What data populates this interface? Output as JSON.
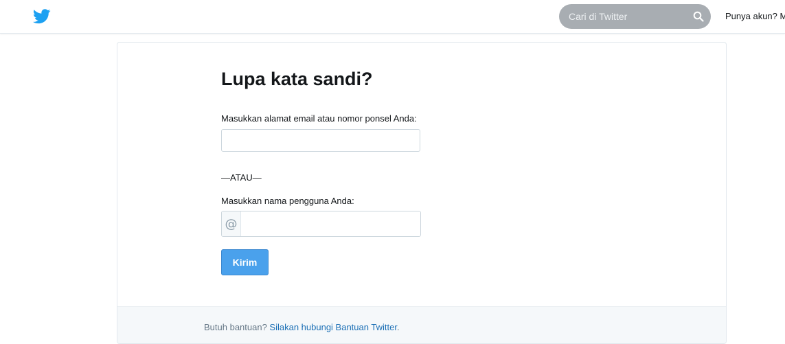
{
  "header": {
    "logo_icon": "twitter-bird-icon",
    "brand_color": "#1da1f2",
    "search": {
      "placeholder": "Cari di Twitter",
      "icon": "search-icon"
    },
    "account_prompt": "Punya akun? Ma"
  },
  "form": {
    "title": "Lupa kata sandi?",
    "email_label": "Masukkan alamat email atau nomor ponsel Anda:",
    "email_value": "",
    "separator": "—ATAU—",
    "username_label": "Masukkan nama pengguna Anda:",
    "username_prefix": "@",
    "username_value": "",
    "submit_label": "Kirim",
    "submit_color": "#4aa1ec"
  },
  "footer": {
    "help_text": "Butuh bantuan? ",
    "help_link": "Silakan hubungi Bantuan Twitter",
    "help_end": "."
  }
}
